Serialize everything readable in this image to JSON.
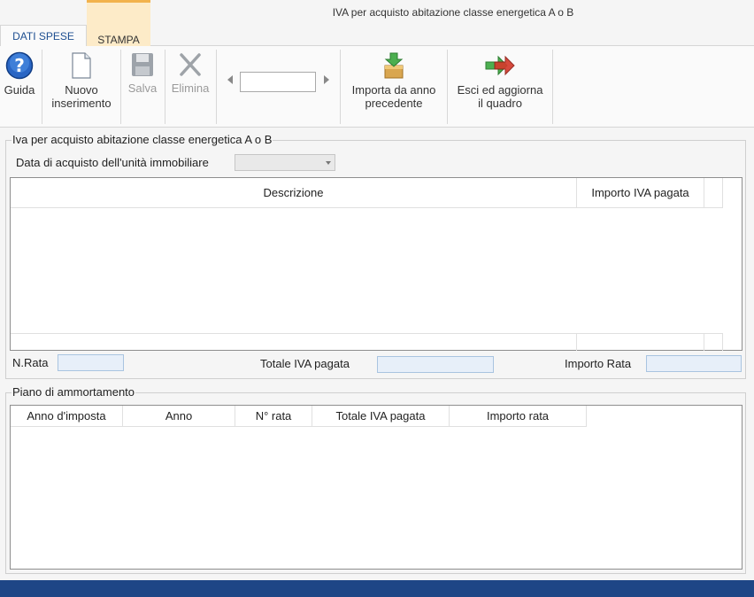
{
  "window": {
    "title": "IVA per acquisto abitazione classe energetica A o B"
  },
  "tabs": [
    {
      "label": "DATI SPESE",
      "active": true
    },
    {
      "label": "STAMPA",
      "active": false
    }
  ],
  "ribbon": {
    "guida": {
      "label": "Guida",
      "icon": "help-icon"
    },
    "nuovo": {
      "line1": "Nuovo",
      "line2": "inserimento",
      "icon": "new-document-icon"
    },
    "salva": {
      "label": "Salva",
      "icon": "save-icon",
      "enabled": false
    },
    "elimina": {
      "label": "Elimina",
      "icon": "delete-icon",
      "enabled": false
    },
    "record_input": {
      "value": ""
    },
    "importa": {
      "line1": "Importa da anno",
      "line2": "precedente",
      "icon": "import-icon"
    },
    "esci": {
      "line1": "Esci ed aggiorna",
      "line2": "il quadro",
      "icon": "exit-arrow-icon"
    }
  },
  "section_iva": {
    "legend": "Iva per acquisto abitazione classe energetica A o B",
    "data_acquisto_label": "Data di acquisto dell'unità immobiliare",
    "data_acquisto_value": "",
    "grid_headers": [
      "Descrizione",
      "Importo IVA pagata"
    ],
    "n_rata_label": "N.Rata",
    "n_rata_value": "",
    "totale_label": "Totale IVA pagata",
    "totale_value": "",
    "importo_rata_label": "Importo Rata",
    "importo_rata_value": ""
  },
  "section_piano": {
    "legend": "Piano di ammortamento",
    "grid_headers": [
      "Anno d'imposta",
      "Anno",
      "N° rata",
      "Totale IVA pagata",
      "Importo rata"
    ]
  },
  "colors": {
    "accent_blue": "#1e4f91",
    "statusbar": "#1e4686",
    "tab_highlight": "#fdebc8"
  }
}
